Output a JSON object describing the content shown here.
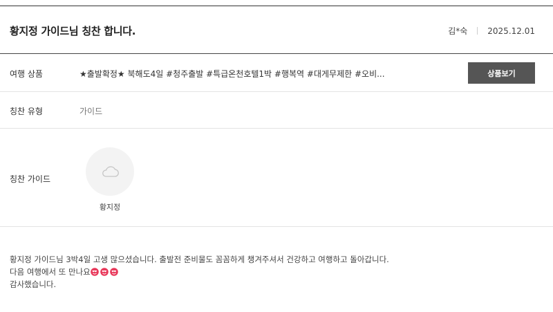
{
  "review": {
    "title": "황지정 가이드님 칭찬 합니다.",
    "author": "김*숙",
    "date": "2025.12.01"
  },
  "product": {
    "label": "여행 상품",
    "name": "★출발확정★ 북해도4일 #청주출발 #특급온천호텔1박 #행복역 #대게무제한 #오비...",
    "button_label": "상품보기"
  },
  "praise_type": {
    "label": "칭찬 유형",
    "value": "가이드"
  },
  "guide": {
    "label": "칭찬 가이드",
    "name": "황지정",
    "avatar_icon": "cloud-icon"
  },
  "body": {
    "line1": "황지정 가이드님 3박4일 고생 많으셨습니다. 출발전 준비물도 꼼꼼하게 챙겨주셔서 건강하고 여행하고 돌아갑니다.",
    "line2": "다음 여행에서 또 만나요",
    "line2_emoji": "heart-eyes-emoji",
    "line2_emoji_count": 3,
    "line3": "감사했습니다."
  }
}
